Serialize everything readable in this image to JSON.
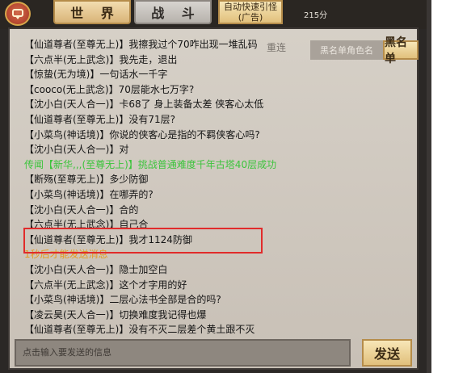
{
  "top_bar": {
    "world_tab": "世 界",
    "battle_tab": "战 斗",
    "quick_guide_line1": "自动快速引怪",
    "quick_guide_line2": "(广告)",
    "score": "215分"
  },
  "chat": {
    "reconnect": "重连",
    "blacklist_placeholder": "黑名单角色名",
    "blacklist_button": "黑名单",
    "messages": [
      {
        "text": "【仙道尊者(至尊无上)】我擦我过个70咋出现一堆乱码",
        "color": "normal"
      },
      {
        "text": "【六点半(无上武念)】我先走，退出",
        "color": "normal"
      },
      {
        "text": "【惊蛰(无为境)】一句话水一千字",
        "color": "normal"
      },
      {
        "text": "【cooco(无上武念)】70层能水七万字?",
        "color": "normal"
      },
      {
        "text": "【沈小白(天人合一)】卡68了 身上装备太差 侠客心太低",
        "color": "normal"
      },
      {
        "text": "【仙道尊者(至尊无上)】没有71层?",
        "color": "normal"
      },
      {
        "text": "【小菜鸟(神话境)】你说的侠客心是指的不羁侠客心吗?",
        "color": "normal"
      },
      {
        "text": "【沈小白(天人合一)】对",
        "color": "normal"
      },
      {
        "text": "传闻【新华,,,(至尊无上)】挑战普通难度千年古塔40层成功",
        "color": "green"
      },
      {
        "text": "【断殇(至尊无上)】多少防御",
        "color": "normal"
      },
      {
        "text": "【小菜鸟(神话境)】在哪弄的?",
        "color": "normal"
      },
      {
        "text": "【沈小白(天人合一)】合的",
        "color": "normal"
      },
      {
        "text": "【六点半(无上武念)】自己合",
        "color": "normal"
      },
      {
        "text": "【仙道尊者(至尊无上)】我才1124防御",
        "color": "normal"
      },
      {
        "text": "1秒后才能发送消息",
        "color": "orange"
      },
      {
        "text": "【沈小白(天人合一)】隐士加空白",
        "color": "normal"
      },
      {
        "text": "【六点半(无上武念)】这个才字用的好",
        "color": "normal"
      },
      {
        "text": "【小菜鸟(神话境)】二层心法书全部是合的吗?",
        "color": "normal"
      },
      {
        "text": "【凌云昊(天人合一)】切换难度我记得也爆",
        "color": "normal"
      },
      {
        "text": "【仙道尊者(至尊无上)】没有不灭二层差个黄土跟不灭",
        "color": "normal"
      }
    ],
    "input_placeholder": "点击输入要发送的信息",
    "send_button": "发送"
  },
  "colors": {
    "highlight": "#e12b2b",
    "rumor": "#3cc43c",
    "system": "#e39b23"
  }
}
